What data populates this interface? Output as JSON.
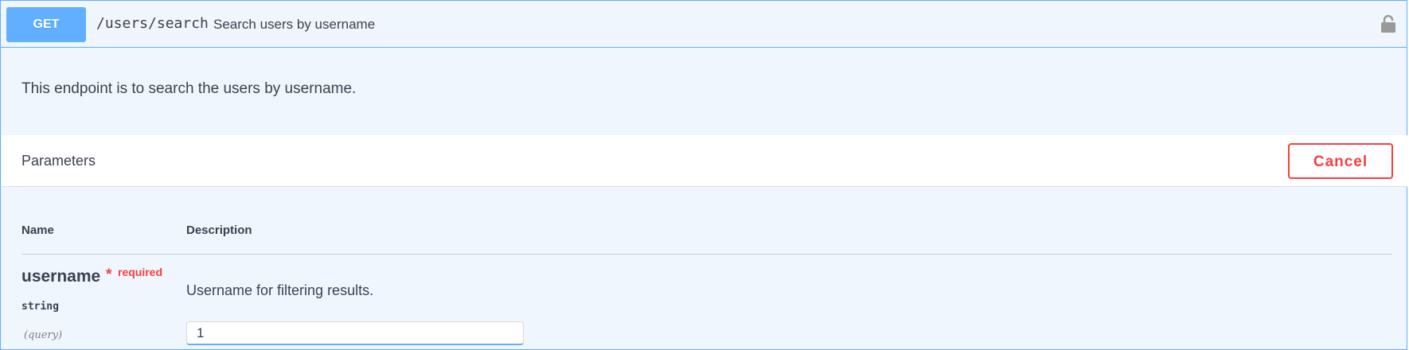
{
  "operation": {
    "method": "GET",
    "path": "/users/search",
    "summary": "Search users by username",
    "lock_icon": "lock-icon",
    "description": "This endpoint is to search the users by username."
  },
  "parameters": {
    "title": "Parameters",
    "cancel_label": "Cancel",
    "columns": {
      "name": "Name",
      "description": "Description"
    },
    "items": [
      {
        "name": "username",
        "required_star": "*",
        "required_label": "required",
        "type": "string",
        "in": "(query)",
        "description": "Username for filtering results.",
        "value": "1"
      }
    ]
  },
  "colors": {
    "get_accent": "#61affe",
    "get_background": "#eff6fe",
    "danger": "#f93e3e"
  }
}
